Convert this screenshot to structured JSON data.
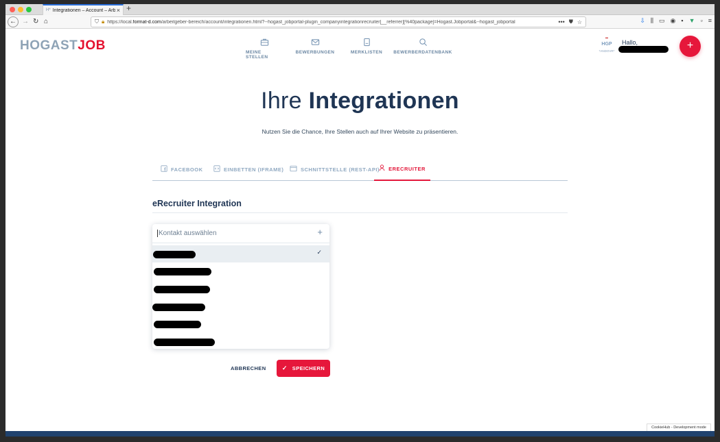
{
  "browser": {
    "tab_title": "Integrationen – Account – Arbei",
    "new_tab": "+",
    "url_prefix": "https://local.",
    "url_domain": "format-d.com",
    "url_path": "/arbeitgeber-bereich/account/integrationen.html?--hogast_jobportal-plugin_companyintegrationrecruiter[__referrer][%40package]=Hogast.Jobportal&--hogast_jobportal",
    "icons": [
      "back-icon",
      "forward-icon",
      "reload-icon",
      "home-icon",
      "shield-icon",
      "lock-icon",
      "more-icon",
      "pocket-icon",
      "star-icon",
      "download-icon",
      "library-icon",
      "sidebar-icon",
      "account-icon",
      "extensions-icon",
      "vue-icon",
      "menu-icon"
    ]
  },
  "header": {
    "logo_part1": "HOGAST",
    "logo_part2": "JOB",
    "nav": [
      {
        "label": "MEINE STELLEN",
        "icon": "briefcase-icon"
      },
      {
        "label": "BEWERBUNGEN",
        "icon": "mail-icon"
      },
      {
        "label": "MERKLISTEN",
        "icon": "document-icon"
      },
      {
        "label": "BEWERBERDATENBANK",
        "icon": "search-icon"
      }
    ],
    "company_logo_text": "HGP",
    "company_logo_subtext": "*ANDOVR*",
    "greeting": "Hallo,",
    "fab_label": "+",
    "colors": {
      "accent": "#e6173b",
      "nav": "#6b87a3",
      "primary": "#1f3554"
    }
  },
  "main": {
    "title_light": "Ihre",
    "title_bold": "Integrationen",
    "subtitle": "Nutzen Sie die Chance, Ihre Stellen auch auf Ihrer Website zu präsentieren.",
    "tabs": [
      {
        "label": "FACEBOOK",
        "icon": "facebook-icon",
        "active": false
      },
      {
        "label": "EINBETTEN (IFRAME)",
        "icon": "code-icon",
        "active": false
      },
      {
        "label": "SCHNITTSTELLE (REST-API)",
        "icon": "window-icon",
        "active": false
      },
      {
        "label": "ERECRUITER",
        "icon": "user-icon",
        "active": true
      }
    ],
    "section_title": "eRecruiter Integration",
    "dropdown": {
      "placeholder": "Kontakt auswählen",
      "add_icon": "plus-icon",
      "selected_index": 0
    },
    "cancel_label": "ABBRECHEN",
    "save_label": "SPEICHERN"
  },
  "cookie_badge": "CookieHub - Development mode"
}
